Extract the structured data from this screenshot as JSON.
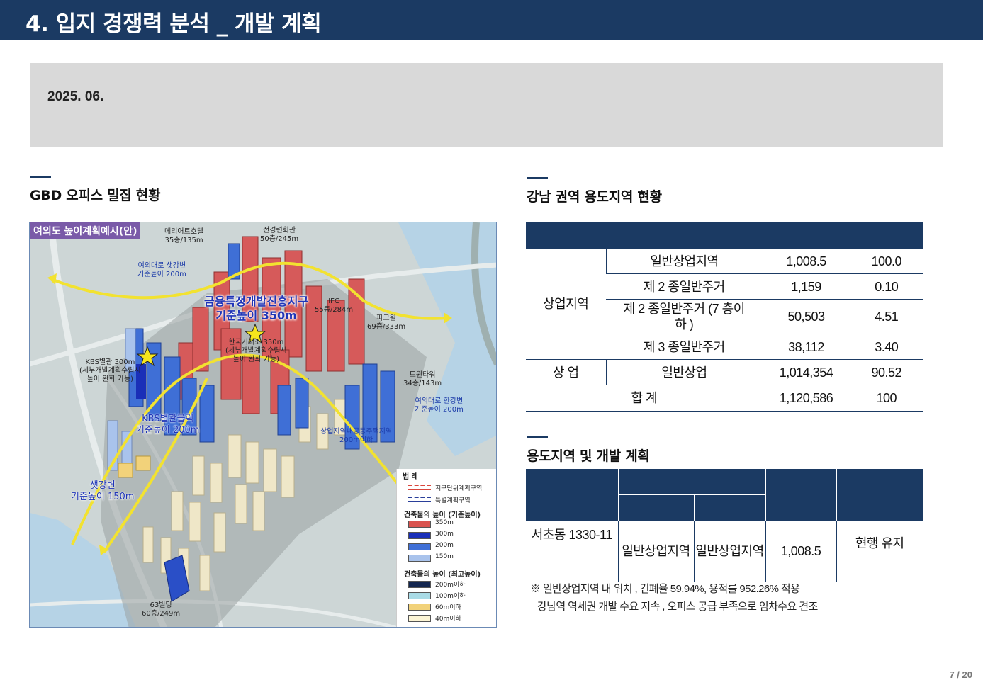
{
  "header": {
    "title": "4.  입지 경쟁력 분석 _ 개발 계획"
  },
  "date_box": {
    "date": "2025. 06."
  },
  "left_section": {
    "title": "GBD  오피스 밀집 현황",
    "map": {
      "tag": "여의도 높이계획예시(안)",
      "labels": {
        "meridien": [
          "메리어트호텔",
          "35층/135m"
        ],
        "chunkyung": [
          "전경련회관",
          "50층/245m"
        ],
        "yeouidaero_west": [
          "여의대로 샛강변",
          "기준높이 200m"
        ],
        "ifc": [
          "IFC",
          "55층/284m"
        ],
        "parc1": [
          "파크원",
          "69층/333m"
        ],
        "kbs_annex": [
          "KBS별관 300m",
          "(세부개발계획수립시",
          "높이 완화 가능)"
        ],
        "krx": [
          "한국거래소 350m",
          "(세부개발계획수립시",
          "높이 완화 가능)"
        ],
        "twin": [
          "트윈타워",
          "34층/143m"
        ],
        "yeouidaero_han": [
          "여의대로 한강변",
          "기준높이 200m"
        ],
        "residential": [
          "상업지역내공동주택지역",
          "200m이하"
        ],
        "sixty_three": [
          "63빌딩",
          "60층/249m"
        ],
        "finance_district": [
          "금융특정개발진흥지구",
          "기준높이 350m"
        ],
        "kbs_block": [
          "KBS별관블럭",
          "기준높이 200m"
        ],
        "saetgang": [
          "샛강변",
          "기준높이 150m"
        ]
      },
      "legend": {
        "title": "범   례",
        "lines": [
          {
            "label": "지구단위계획구역",
            "color": "#d9463c"
          },
          {
            "label": "특별계획구역",
            "color": "#2a3f9a"
          }
        ],
        "height_std_title": "건축물의 높이 (기준높이)",
        "height_std": [
          {
            "label": "350m",
            "color": "#d9534f"
          },
          {
            "label": "300m",
            "color": "#1a2fb8"
          },
          {
            "label": "200m",
            "color": "#3f6fd6"
          },
          {
            "label": "150m",
            "color": "#a9c3ec"
          }
        ],
        "height_max_title": "건축물의 높이 (최고높이)",
        "height_max": [
          {
            "label": "200m이하",
            "color": "#13264f"
          },
          {
            "label": "100m이하",
            "color": "#a9dbe6"
          },
          {
            "label": "60m이하",
            "color": "#f2d27a"
          },
          {
            "label": "40m이하",
            "color": "#fbf4d5"
          }
        ]
      }
    }
  },
  "zoning_section": {
    "title": "강남 권역 용도지역 현황",
    "headers": [
      "",
      "",
      ""
    ],
    "group_label": "상업지역",
    "rows": [
      {
        "type": "일반상업지역",
        "area": "1,008.5",
        "ratio": "100.0"
      },
      {
        "type": "제 2 종일반주거",
        "area": "1,159",
        "ratio": "0.10"
      },
      {
        "type": "제 2 종일반주거 (7 층이하 )",
        "area": "50,503",
        "ratio": "4.51"
      },
      {
        "type": "제 3 종일반주거",
        "area": "38,112",
        "ratio": "3.40"
      }
    ],
    "commercial": {
      "label": "상  업",
      "type": "일반상업",
      "area": "1,014,354",
      "ratio": "90.52"
    },
    "total": {
      "label": "합  계",
      "area": "1,120,586",
      "ratio": "100"
    }
  },
  "plan_section": {
    "title": "용도지역 및 개발 계획",
    "row": {
      "location": "서초동  1330-11",
      "zone_current": "일반상업지역",
      "zone_plan": "일반상업지역",
      "area": "1,008.5",
      "plan": "현행 유지"
    },
    "notes": [
      "※ 일반상업지역 내 위치 ,  건폐율  59.94%,  용적률  952.26%  적용",
      "강남역 역세권 개발 수요 지속 ,  오피스 공급 부족으로 임차수요 견조"
    ]
  },
  "pager": "7 / 20"
}
